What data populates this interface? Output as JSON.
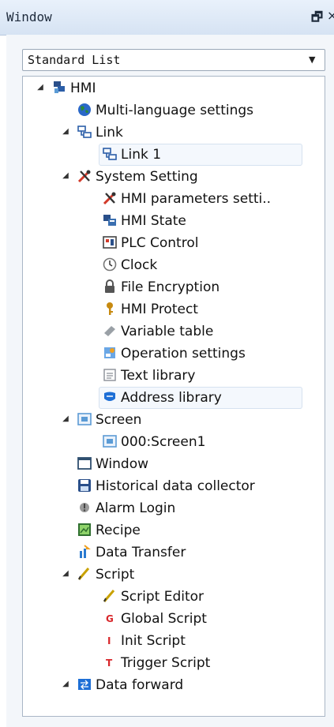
{
  "window": {
    "title": "Window",
    "pin_icon": "pin-icon",
    "close_icon": "close-icon"
  },
  "view_select": {
    "value": "Standard List",
    "arrow_icon": "chevron-down-icon"
  },
  "tree": {
    "items": [
      {
        "label": "HMI",
        "level": 0,
        "expanded": true,
        "icon": "hmi-icon",
        "color": "#2b5ea8"
      },
      {
        "label": "Multi-language settings",
        "level": 1,
        "icon": "globe-icon",
        "color": "#2a8a3a"
      },
      {
        "label": "Link",
        "level": 1,
        "expanded": true,
        "icon": "link-icon",
        "color": "#2b5ea8"
      },
      {
        "label": "Link 1",
        "level": 2,
        "icon": "link-icon",
        "color": "#2b5ea8",
        "selected": true
      },
      {
        "label": "System Setting",
        "level": 1,
        "expanded": true,
        "icon": "tools-icon",
        "color": "#d23a2a"
      },
      {
        "label": "HMI parameters setti..",
        "level": 2,
        "icon": "tools-icon",
        "color": "#d23a2a"
      },
      {
        "label": "HMI State",
        "level": 2,
        "icon": "state-icon",
        "color": "#3a6fb0"
      },
      {
        "label": "PLC Control",
        "level": 2,
        "icon": "plc-icon",
        "color": "#444444"
      },
      {
        "label": "Clock",
        "level": 2,
        "icon": "clock-icon",
        "color": "#777777"
      },
      {
        "label": "File Encryption",
        "level": 2,
        "icon": "lock-icon",
        "color": "#555555"
      },
      {
        "label": "HMI Protect",
        "level": 2,
        "icon": "key-icon",
        "color": "#c78a10"
      },
      {
        "label": "Variable table",
        "level": 2,
        "icon": "table-icon",
        "color": "#9aa0a6"
      },
      {
        "label": "Operation settings",
        "level": 2,
        "icon": "operation-icon",
        "color": "#3a84d0"
      },
      {
        "label": "Text library",
        "level": 2,
        "icon": "text-icon",
        "color": "#8a8f96"
      },
      {
        "label": "Address library",
        "level": 2,
        "icon": "address-icon",
        "color": "#1e6fd6",
        "selected": true
      },
      {
        "label": "Screen",
        "level": 1,
        "expanded": true,
        "icon": "screen-icon",
        "color": "#5b9bd5"
      },
      {
        "label": "000:Screen1",
        "level": 2,
        "icon": "screen-icon",
        "color": "#5b9bd5"
      },
      {
        "label": "Window",
        "level": 1,
        "icon": "window-icon",
        "color": "#2f4f6f"
      },
      {
        "label": "Historical data collector",
        "level": 1,
        "icon": "disk-icon",
        "color": "#2a4f8a"
      },
      {
        "label": "Alarm Login",
        "level": 1,
        "icon": "alarm-icon",
        "color": "#777777"
      },
      {
        "label": "Recipe",
        "level": 1,
        "icon": "recipe-icon",
        "color": "#3a8a3a"
      },
      {
        "label": "Data Transfer",
        "level": 1,
        "icon": "transfer-icon",
        "color": "#2a7ad0"
      },
      {
        "label": "Script",
        "level": 1,
        "expanded": true,
        "icon": "pen-icon",
        "color": "#c9a200"
      },
      {
        "label": "Script Editor",
        "level": 2,
        "icon": "pen-icon",
        "color": "#c9a200"
      },
      {
        "label": "Global Script",
        "level": 2,
        "icon": "g-script-icon",
        "color": "#d8262a"
      },
      {
        "label": "Init Script",
        "level": 2,
        "icon": "i-script-icon",
        "color": "#d8262a"
      },
      {
        "label": "Trigger Script",
        "level": 2,
        "icon": "t-script-icon",
        "color": "#d8262a"
      },
      {
        "label": "Data forward",
        "level": 1,
        "expanded": true,
        "icon": "forward-icon",
        "color": "#1e6fd6"
      }
    ]
  },
  "scrollbar": {
    "up_icon": "scroll-up-icon",
    "down_icon": "scroll-down-icon",
    "grip_icon": "grip-icon"
  }
}
